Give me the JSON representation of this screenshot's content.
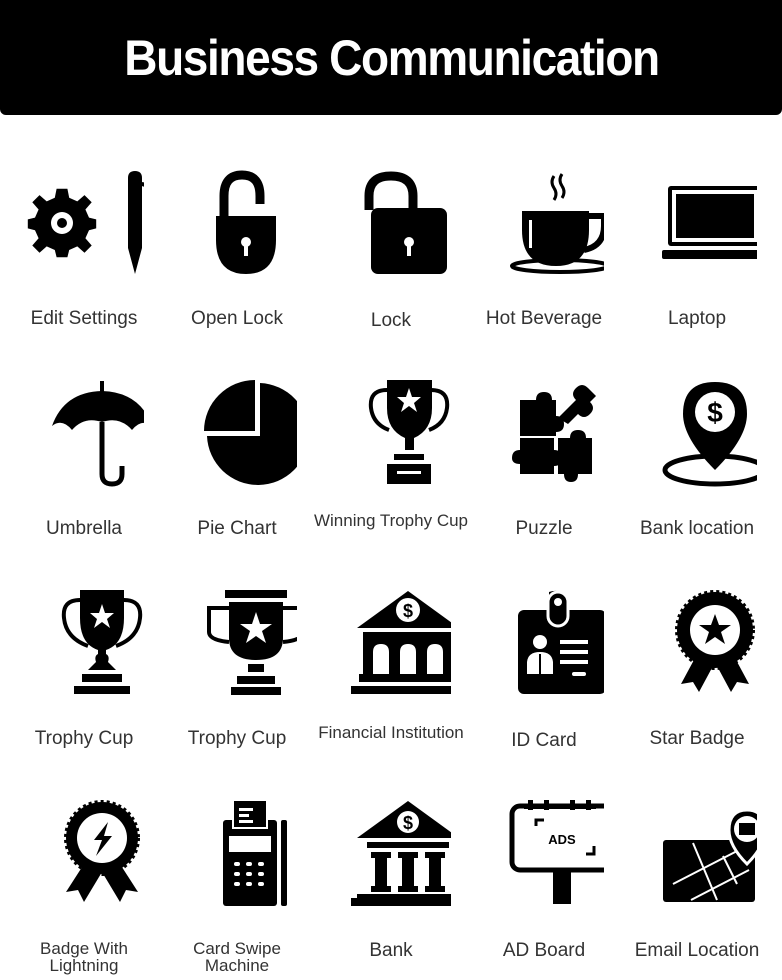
{
  "header": {
    "title": "Business Communication"
  },
  "colors": {
    "header_bg": "#000000",
    "header_text": "#ffffff",
    "icon": "#000000",
    "label": "#333333"
  },
  "icons": [
    {
      "name": "edit-settings-icon",
      "label": "Edit Settings"
    },
    {
      "name": "open-lock-icon",
      "label": "Open Lock"
    },
    {
      "name": "lock-icon",
      "label": "Lock"
    },
    {
      "name": "hot-beverage-icon",
      "label": "Hot Beverage"
    },
    {
      "name": "laptop-icon",
      "label": "Laptop"
    },
    {
      "name": "umbrella-icon",
      "label": "Umbrella"
    },
    {
      "name": "pie-chart-icon",
      "label": "Pie Chart"
    },
    {
      "name": "winning-trophy-cup-icon",
      "label": "Winning Trophy Cup"
    },
    {
      "name": "puzzle-icon",
      "label": "Puzzle"
    },
    {
      "name": "bank-location-icon",
      "label": "Bank location"
    },
    {
      "name": "trophy-cup-icon",
      "label": "Trophy Cup"
    },
    {
      "name": "trophy-cup-2-icon",
      "label": "Trophy Cup"
    },
    {
      "name": "financial-institution-icon",
      "label": "Financial Institution"
    },
    {
      "name": "id-card-icon",
      "label": "ID Card"
    },
    {
      "name": "star-badge-icon",
      "label": "Star Badge"
    },
    {
      "name": "badge-with-lightning-icon",
      "label": "Badge With Lightning"
    },
    {
      "name": "card-swipe-machine-icon",
      "label": "Card Swipe Machine"
    },
    {
      "name": "bank-icon",
      "label": "Bank"
    },
    {
      "name": "ad-board-icon",
      "label": "AD Board"
    },
    {
      "name": "email-location-icon",
      "label": "Email Location"
    }
  ],
  "ad_board_text": "ADS"
}
